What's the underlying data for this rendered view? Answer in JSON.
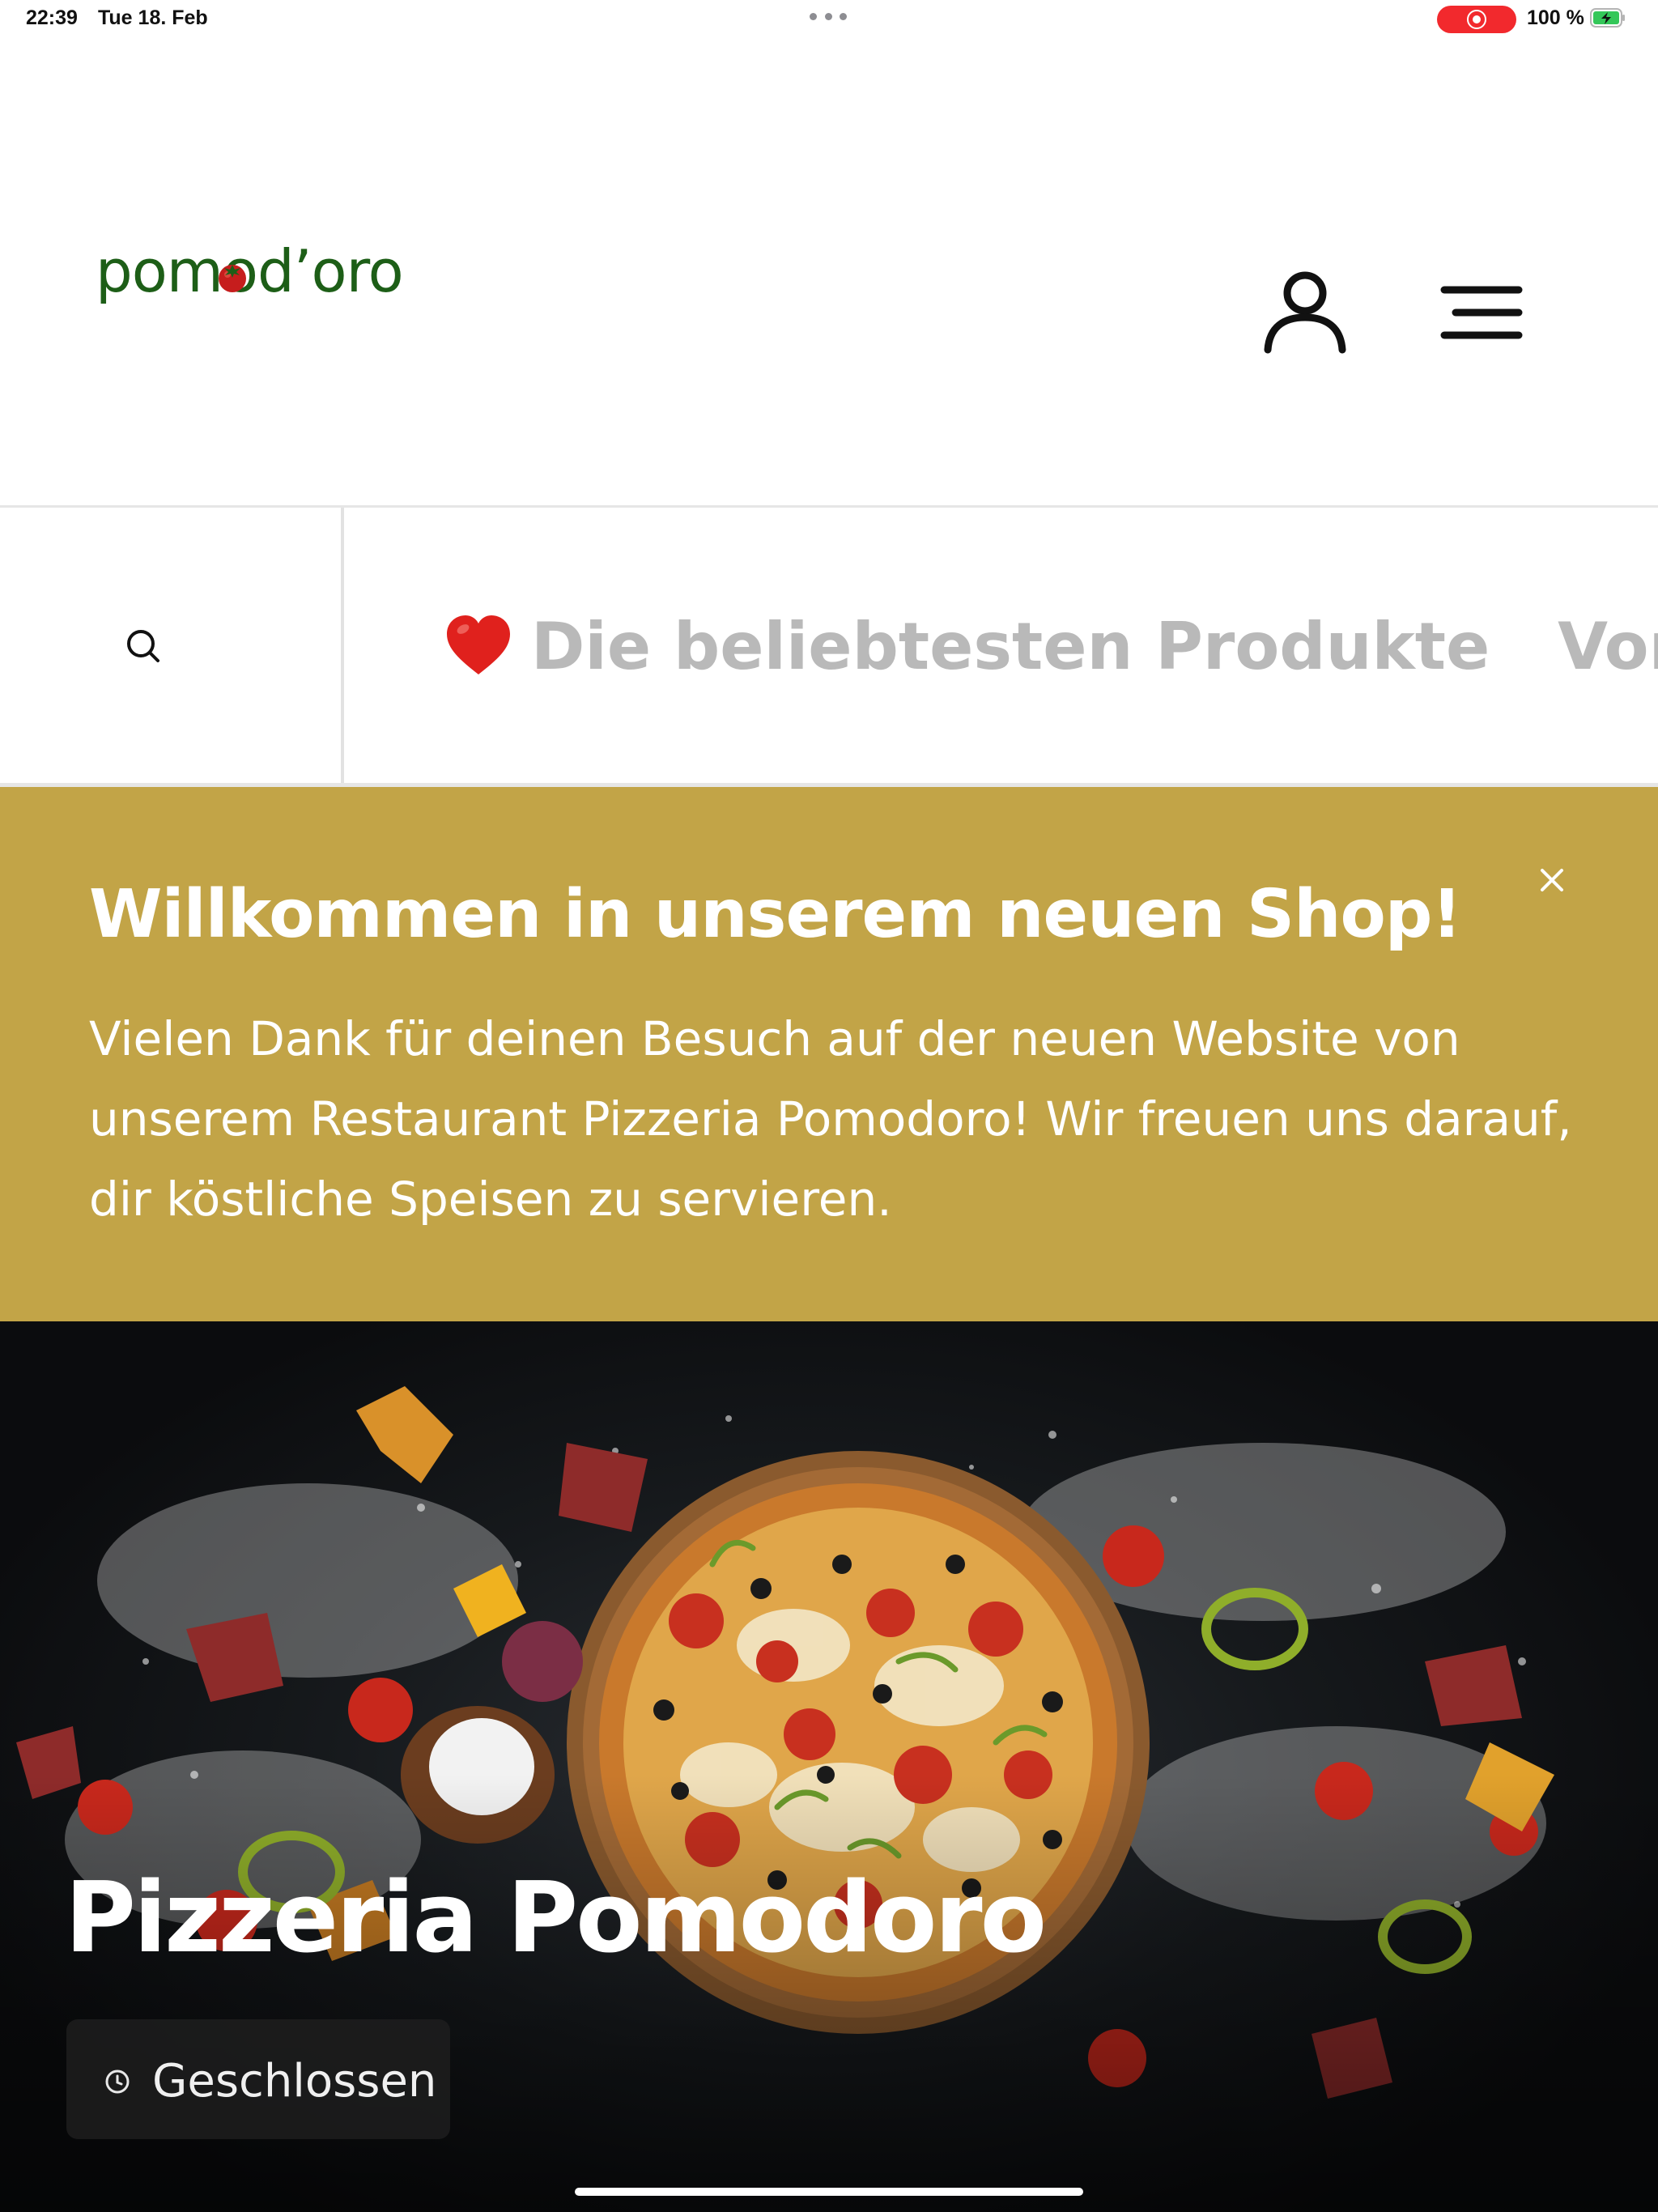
{
  "status_bar": {
    "time": "22:39",
    "date": "Tue 18. Feb",
    "battery_percent": "100 %",
    "recording_color": "#f2292d"
  },
  "header": {
    "logo_text": "pomod’oro",
    "logo_color": "#1d5e17",
    "user_icon": "user-icon",
    "menu_icon": "hamburger-menu-icon"
  },
  "category_nav": {
    "search_icon": "search-icon",
    "items": [
      {
        "emoji": "heart-icon",
        "label": "Die beliebtesten Produkte"
      },
      {
        "label": "Vorspei"
      }
    ],
    "text_color": "#b9b9b9"
  },
  "banner": {
    "title": "Willkommen in unserem neuen Shop!",
    "text": "Vielen Dank für deinen Besuch auf der neuen Website von unserem Restaurant Pizzeria Pomodoro! Wir freuen uns darauf, dir köstliche Speisen zu servieren.",
    "close_icon": "close-icon",
    "background": "#c2a447"
  },
  "hero": {
    "title": "Pizzeria Pomodoro",
    "status": "Geschlossen",
    "status_icon": "clock-icon"
  }
}
